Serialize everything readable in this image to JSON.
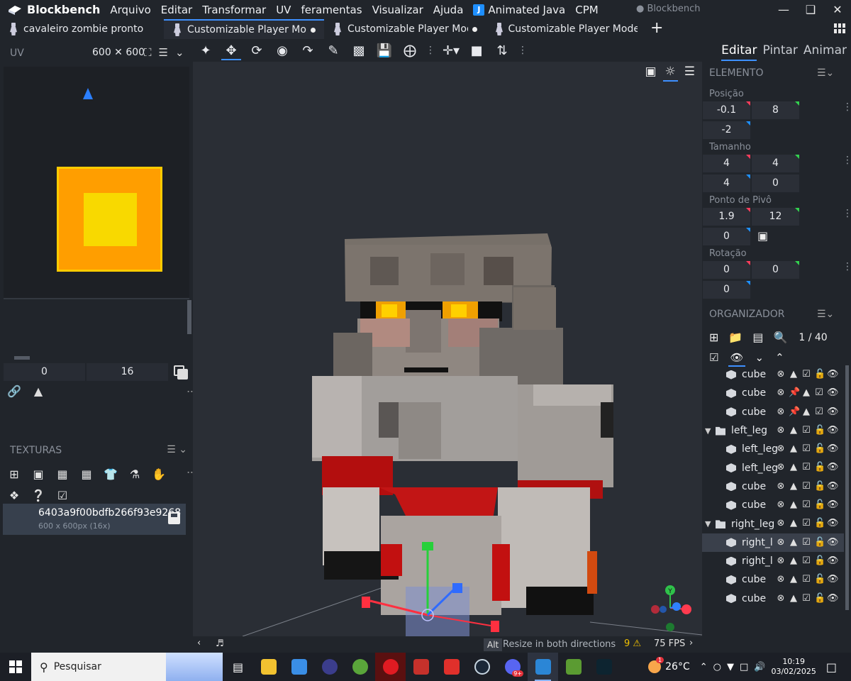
{
  "app": {
    "name": "Blockbench",
    "window_title": "● Blockbench"
  },
  "menu": [
    "Arquivo",
    "Editar",
    "Transformar",
    "UV",
    "feramentas",
    "Visualizar",
    "Ajuda",
    "Animated Java",
    "CPM"
  ],
  "tabs": [
    {
      "label": "cavaleiro zombie pronto",
      "active": false,
      "unsaved": false
    },
    {
      "label": "Customizable Player Models",
      "active": true,
      "unsaved": true
    },
    {
      "label": "Customizable Player Models",
      "active": false,
      "unsaved": true
    },
    {
      "label": "Customizable Player Models m",
      "active": false,
      "unsaved": false
    }
  ],
  "uv_panel": {
    "title": "UV",
    "size": "600 ✕ 600",
    "x": "0",
    "y": "16"
  },
  "textures_panel": {
    "title": "TEXTURAS",
    "texture": {
      "name": "6403a9f00bdfb266f93e9268",
      "info": "600 x 600px (16x)"
    }
  },
  "modes": [
    {
      "label": "Editar",
      "active": true
    },
    {
      "label": "Pintar",
      "active": false
    },
    {
      "label": "Animar",
      "active": false
    }
  ],
  "element_panel": {
    "title": "ELEMENTO",
    "position": {
      "label": "Posição",
      "x": "-0.1",
      "y": "8",
      "z": "-2"
    },
    "size": {
      "label": "Tamanho",
      "x": "4",
      "y": "4",
      "z": "4",
      "inflate": "0"
    },
    "pivot": {
      "label": "Ponto de Pivô",
      "x": "1.9",
      "y": "12",
      "z": "0"
    },
    "rotation": {
      "label": "Rotação",
      "x": "0",
      "y": "0",
      "z": "0"
    }
  },
  "outliner": {
    "title": "ORGANIZADOR",
    "counter": "1 / 40",
    "items": [
      {
        "label": "cube",
        "type": "cube",
        "depth": 2,
        "pinned": false
      },
      {
        "label": "cube",
        "type": "cube",
        "depth": 2,
        "pinned": true
      },
      {
        "label": "cube",
        "type": "cube",
        "depth": 2,
        "pinned": true
      },
      {
        "label": "left_leg",
        "type": "group",
        "depth": 1
      },
      {
        "label": "left_leg",
        "type": "cube",
        "depth": 2
      },
      {
        "label": "left_leg",
        "type": "cube",
        "depth": 2
      },
      {
        "label": "cube",
        "type": "cube",
        "depth": 2
      },
      {
        "label": "cube",
        "type": "cube",
        "depth": 2
      },
      {
        "label": "right_leg",
        "type": "group",
        "depth": 1
      },
      {
        "label": "right_leg",
        "type": "cube",
        "depth": 2,
        "selected": true
      },
      {
        "label": "right_leg",
        "type": "cube",
        "depth": 2
      },
      {
        "label": "cube",
        "type": "cube",
        "depth": 2
      },
      {
        "label": "cube",
        "type": "cube",
        "depth": 2
      }
    ]
  },
  "status": {
    "key": "Alt",
    "hint": "Resize in both directions",
    "warnings": "9",
    "fps": "75 FPS"
  },
  "taskbar": {
    "search_placeholder": "Pesquisar",
    "weather": "26°C",
    "time": "10:19",
    "date": "03/02/2025",
    "notif_badge": "1",
    "discord_badge": "9+"
  },
  "colors": {
    "accent": "#3e90ff",
    "uv_outer": "#ff9e00",
    "uv_inner": "#f8d900",
    "panel": "#21252b",
    "viewport": "#2a2e35"
  }
}
